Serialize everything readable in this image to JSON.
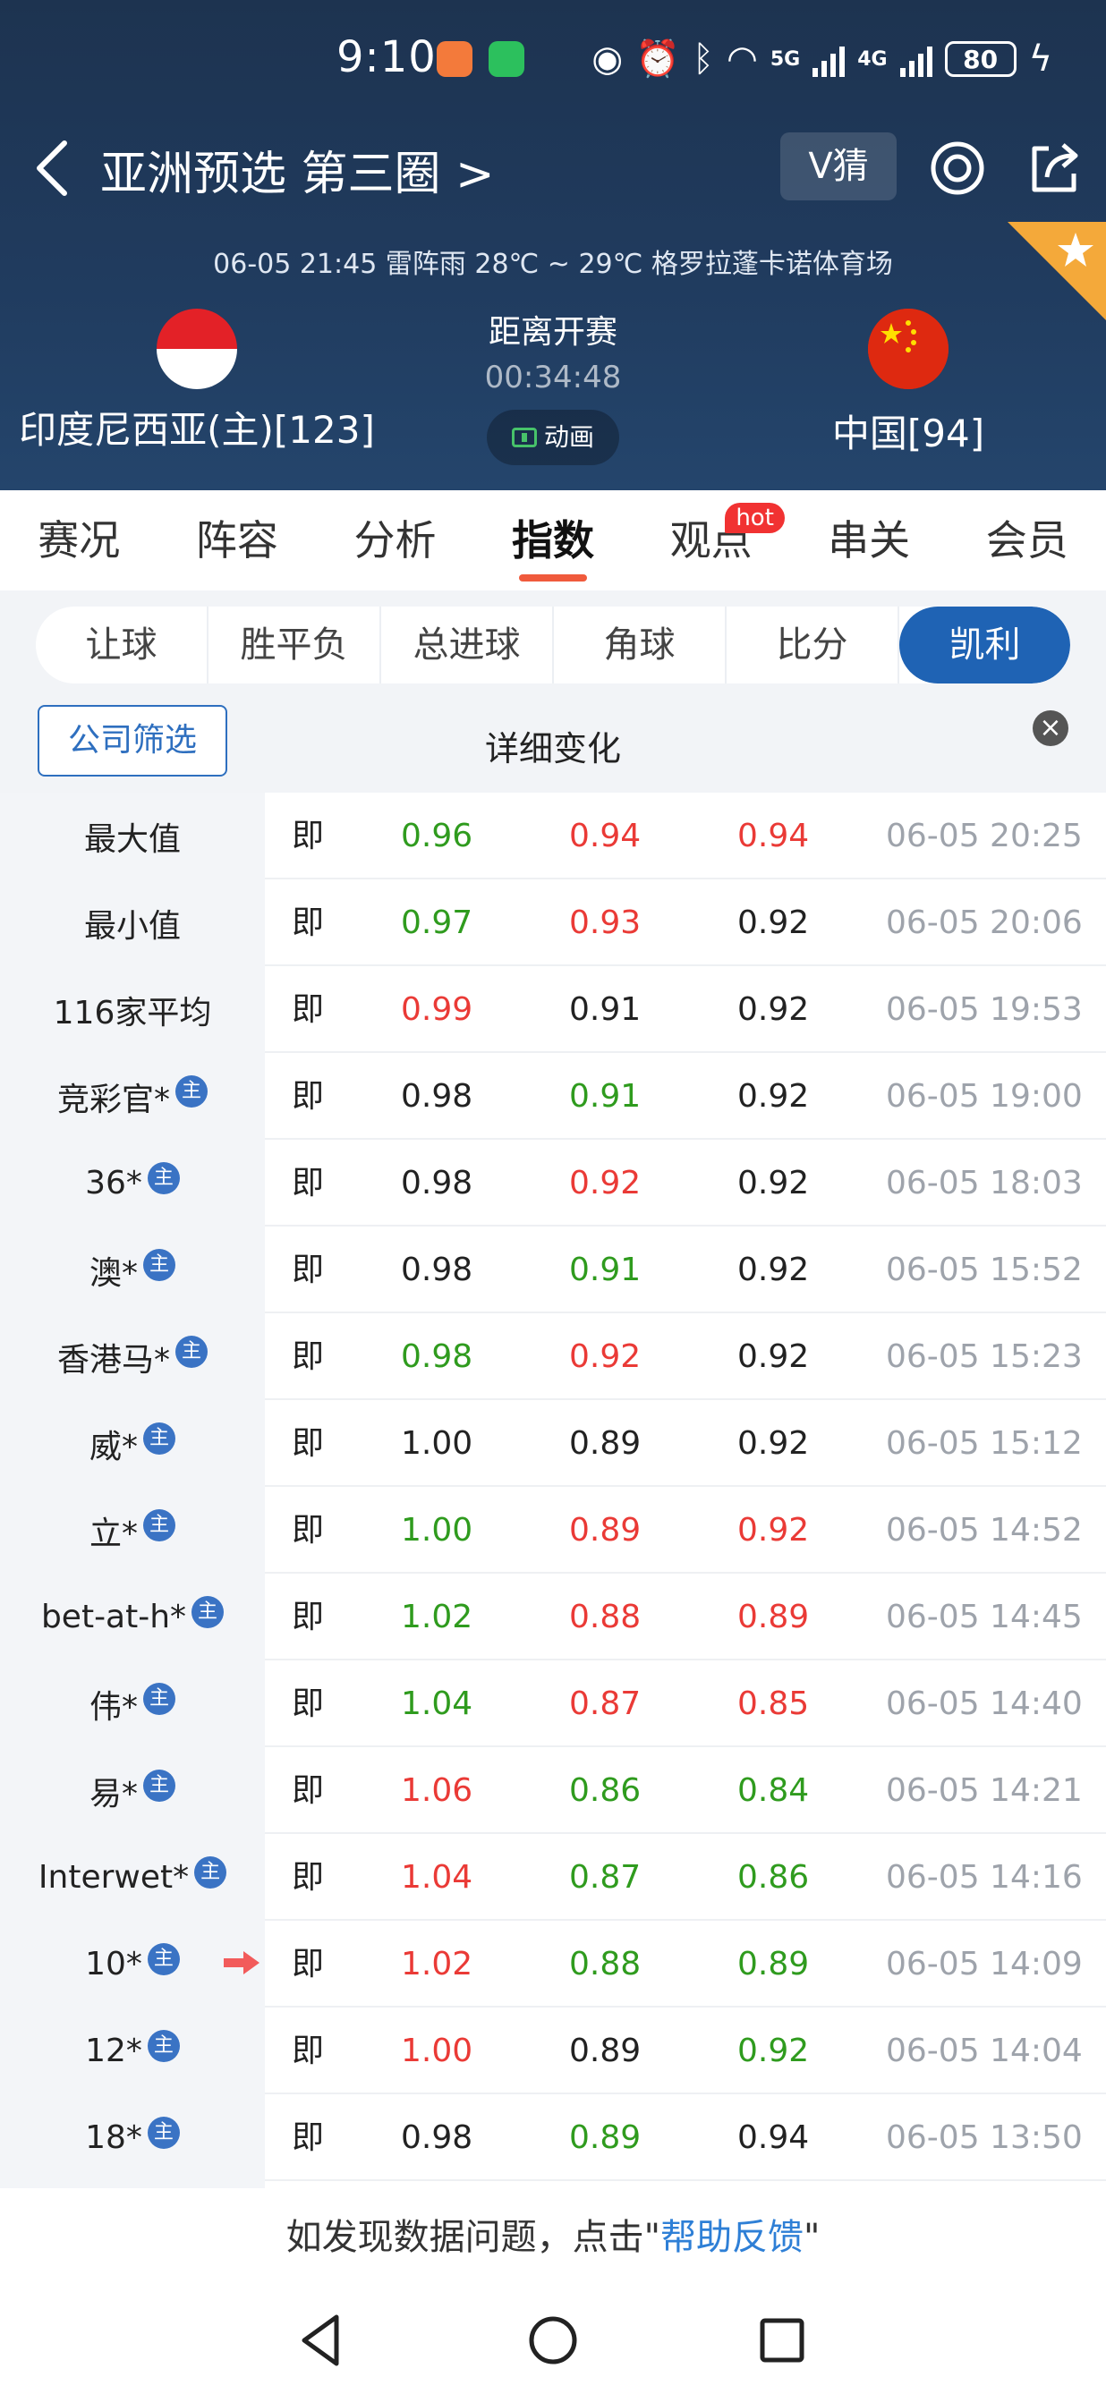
{
  "status": {
    "time": "9:10",
    "net1": "5G",
    "net2": "4G",
    "battery": "80"
  },
  "header": {
    "title": "亚洲预选 第三圈 >",
    "vguess": "V猜"
  },
  "match": {
    "info": "06-05 21:45   雷阵雨 28℃ ~ 29℃   格罗拉蓬卡诺体育场",
    "home": "印度尼西亚(主)[123]",
    "away": "中国[94]",
    "kickoff_label": "距离开赛",
    "countdown": "00:34:48",
    "anim_label": "动画"
  },
  "tabs": [
    "赛况",
    "阵容",
    "分析",
    "指数",
    "观点",
    "串关",
    "会员"
  ],
  "hot_badge": "hot",
  "subtabs": [
    "让球",
    "胜平负",
    "总进球",
    "角球",
    "比分",
    "凯利"
  ],
  "filter": {
    "button": "公司筛选",
    "title": "详细变化",
    "close": "×"
  },
  "zhu_label": "主",
  "colors": {
    "header_bg": "#1d3350",
    "accent": "#1f63b4",
    "up": "#ea3a36",
    "down": "#2f9b1e",
    "tab_underline": "#f05a3c"
  },
  "rows": [
    {
      "company": "最大值",
      "badge": false,
      "ji": "即",
      "v1": "0.96",
      "c1": "green",
      "v2": "0.94",
      "c2": "red",
      "v3": "0.94",
      "c3": "red",
      "time": "06-05 20:25"
    },
    {
      "company": "最小值",
      "badge": false,
      "ji": "即",
      "v1": "0.97",
      "c1": "green",
      "v2": "0.93",
      "c2": "red",
      "v3": "0.92",
      "c3": "black",
      "time": "06-05 20:06"
    },
    {
      "company": "116家平均",
      "badge": false,
      "ji": "即",
      "v1": "0.99",
      "c1": "red",
      "v2": "0.91",
      "c2": "black",
      "v3": "0.92",
      "c3": "black",
      "time": "06-05 19:53"
    },
    {
      "company": "竞彩官*",
      "badge": true,
      "ji": "即",
      "v1": "0.98",
      "c1": "black",
      "v2": "0.91",
      "c2": "green",
      "v3": "0.92",
      "c3": "black",
      "time": "06-05 19:00"
    },
    {
      "company": "36*",
      "badge": true,
      "ji": "即",
      "v1": "0.98",
      "c1": "black",
      "v2": "0.92",
      "c2": "red",
      "v3": "0.92",
      "c3": "black",
      "time": "06-05 18:03"
    },
    {
      "company": "澳*",
      "badge": true,
      "ji": "即",
      "v1": "0.98",
      "c1": "black",
      "v2": "0.91",
      "c2": "green",
      "v3": "0.92",
      "c3": "black",
      "time": "06-05 15:52"
    },
    {
      "company": "香港马*",
      "badge": true,
      "ji": "即",
      "v1": "0.98",
      "c1": "green",
      "v2": "0.92",
      "c2": "red",
      "v3": "0.92",
      "c3": "black",
      "time": "06-05 15:23"
    },
    {
      "company": "威*",
      "badge": true,
      "ji": "即",
      "v1": "1.00",
      "c1": "black",
      "v2": "0.89",
      "c2": "black",
      "v3": "0.92",
      "c3": "black",
      "time": "06-05 15:12"
    },
    {
      "company": "立*",
      "badge": true,
      "ji": "即",
      "v1": "1.00",
      "c1": "green",
      "v2": "0.89",
      "c2": "red",
      "v3": "0.92",
      "c3": "red",
      "time": "06-05 14:52"
    },
    {
      "company": "bet-at-h*",
      "badge": true,
      "ji": "即",
      "v1": "1.02",
      "c1": "green",
      "v2": "0.88",
      "c2": "red",
      "v3": "0.89",
      "c3": "red",
      "time": "06-05 14:45"
    },
    {
      "company": "伟*",
      "badge": true,
      "ji": "即",
      "v1": "1.04",
      "c1": "green",
      "v2": "0.87",
      "c2": "red",
      "v3": "0.85",
      "c3": "red",
      "time": "06-05 14:40"
    },
    {
      "company": "易*",
      "badge": true,
      "ji": "即",
      "v1": "1.06",
      "c1": "red",
      "v2": "0.86",
      "c2": "green",
      "v3": "0.84",
      "c3": "green",
      "time": "06-05 14:21"
    },
    {
      "company": "Interwet*",
      "badge": true,
      "ji": "即",
      "v1": "1.04",
      "c1": "red",
      "v2": "0.87",
      "c2": "green",
      "v3": "0.86",
      "c3": "green",
      "time": "06-05 14:16"
    },
    {
      "company": "10*",
      "badge": true,
      "ji": "即",
      "v1": "1.02",
      "c1": "red",
      "v2": "0.88",
      "c2": "green",
      "v3": "0.89",
      "c3": "green",
      "time": "06-05 14:09",
      "arrow": true
    },
    {
      "company": "12*",
      "badge": true,
      "ji": "即",
      "v1": "1.00",
      "c1": "red",
      "v2": "0.89",
      "c2": "black",
      "v3": "0.92",
      "c3": "green",
      "time": "06-05 14:04"
    },
    {
      "company": "18*",
      "badge": true,
      "ji": "即",
      "v1": "0.98",
      "c1": "black",
      "v2": "0.89",
      "c2": "green",
      "v3": "0.94",
      "c3": "black",
      "time": "06-05 13:50"
    }
  ],
  "footer": {
    "text_before": "如发现数据问题，点击\"",
    "link": "帮助反馈",
    "text_after": "\""
  }
}
